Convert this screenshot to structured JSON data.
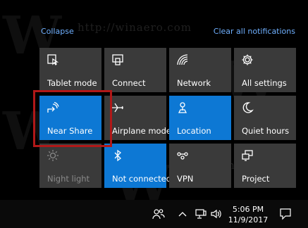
{
  "header": {
    "collapse": "Collapse",
    "clear_all": "Clear all notifications"
  },
  "tiles": [
    {
      "label": "Tablet mode",
      "icon": "tablet-mode-icon",
      "state": "off"
    },
    {
      "label": "Connect",
      "icon": "connect-icon",
      "state": "off"
    },
    {
      "label": "Network",
      "icon": "network-icon",
      "state": "off"
    },
    {
      "label": "All settings",
      "icon": "gear-icon",
      "state": "off"
    },
    {
      "label": "Near Share",
      "icon": "near-share-icon",
      "state": "on"
    },
    {
      "label": "Airplane mode",
      "icon": "airplane-icon",
      "state": "off"
    },
    {
      "label": "Location",
      "icon": "location-icon",
      "state": "on"
    },
    {
      "label": "Quiet hours",
      "icon": "moon-icon",
      "state": "off"
    },
    {
      "label": "Night light",
      "icon": "sun-icon",
      "state": "disabled"
    },
    {
      "label": "Not connected",
      "icon": "bluetooth-icon",
      "state": "on"
    },
    {
      "label": "VPN",
      "icon": "vpn-icon",
      "state": "off"
    },
    {
      "label": "Project",
      "icon": "project-icon",
      "state": "off"
    }
  ],
  "taskbar": {
    "time": "5:06 PM",
    "date": "11/9/2017"
  },
  "watermark": {
    "url": "http://winaero.com",
    "letter": "W"
  },
  "colors": {
    "accent": "#0d78d4",
    "tile": "#3a3a3a",
    "link": "#6fb0ff",
    "highlight": "#b01818"
  }
}
